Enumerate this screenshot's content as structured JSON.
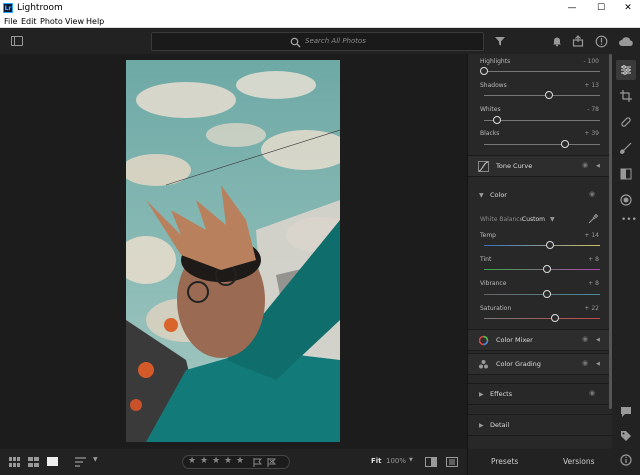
{
  "window": {
    "title": "Lightroom",
    "logo": "Lr",
    "min": "—",
    "max": "☐",
    "close": "✕"
  },
  "menu": [
    "File",
    "Edit",
    "Photo",
    "View",
    "Help"
  ],
  "search": {
    "placeholder": "Search All Photos"
  },
  "light": {
    "highlights": {
      "label": "Highlights",
      "value": "- 100",
      "level": 0.0
    },
    "shadows": {
      "label": "Shadows",
      "value": "+ 13",
      "level": 0.56
    },
    "whites": {
      "label": "Whites",
      "value": "- 78",
      "level": 0.11
    },
    "blacks": {
      "label": "Blacks",
      "value": "+ 39",
      "level": 0.7
    }
  },
  "tone_curve": {
    "label": "Tone Curve"
  },
  "color": {
    "label": "Color",
    "wb_label": "White Balance",
    "wb_value": "Custom",
    "temp": {
      "label": "Temp",
      "value": "+ 14",
      "level": 0.57
    },
    "tint": {
      "label": "Tint",
      "value": "+ 8",
      "level": 0.54
    },
    "vibrance": {
      "label": "Vibrance",
      "value": "+ 8",
      "level": 0.54
    },
    "saturation": {
      "label": "Saturation",
      "value": "+ 22",
      "level": 0.61
    }
  },
  "color_mixer": {
    "label": "Color Mixer"
  },
  "color_grading": {
    "label": "Color Grading"
  },
  "effects": {
    "label": "Effects"
  },
  "detail": {
    "label": "Detail"
  },
  "bottom": {
    "fit": "Fit",
    "zoom": "100%",
    "presets": "Presets",
    "versions": "Versions"
  },
  "colors": {
    "accent": "#31a8ff",
    "panel": "#282828",
    "canvas": "#1c1c1c"
  }
}
